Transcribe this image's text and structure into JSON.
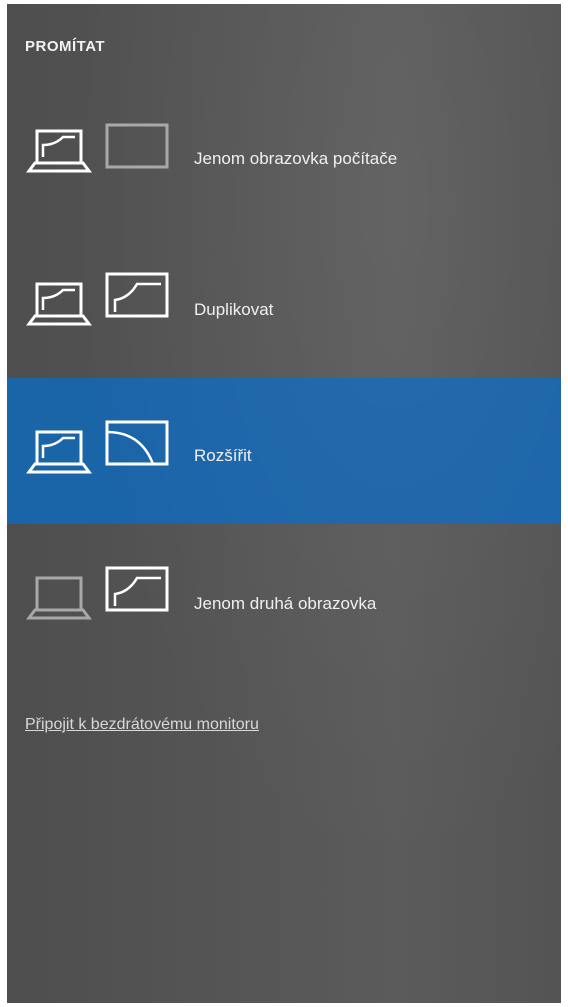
{
  "panel": {
    "title": "PROMÍTAT",
    "options": [
      {
        "label": "Jenom obrazovka počítače",
        "icon": "pc-screen-only-icon",
        "selected": false
      },
      {
        "label": "Duplikovat",
        "icon": "duplicate-icon",
        "selected": false
      },
      {
        "label": "Rozšířit",
        "icon": "extend-icon",
        "selected": true
      },
      {
        "label": "Jenom druhá obrazovka",
        "icon": "second-screen-only-icon",
        "selected": false
      }
    ],
    "connect_link": "Připojit k bezdrátovému monitoru"
  },
  "colors": {
    "panel_bg": "#555555",
    "selected_bg": "#1a64a8",
    "text": "#f0f0f0"
  }
}
